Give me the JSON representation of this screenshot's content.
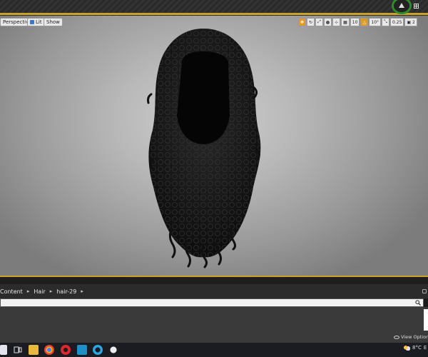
{
  "viewport": {
    "buttons": {
      "perspective": "Perspective",
      "lit": "Lit",
      "show": "Show"
    },
    "tools": {
      "grid_snap": "10",
      "rotation_snap": "10°",
      "scale_snap": "0.25",
      "camera_speed": "2"
    }
  },
  "content_browser": {
    "breadcrumb": [
      "Content",
      "Hair",
      "hair-29"
    ],
    "view_options_label": "View Options"
  },
  "taskbar": {
    "temperature": "8°C",
    "extra": "E"
  },
  "colors": {
    "accent": "#c9a227",
    "green_ring": "#2e8b2e",
    "orange_tool": "#e09a2a"
  }
}
